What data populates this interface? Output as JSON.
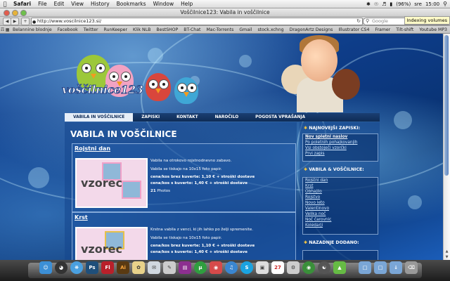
{
  "menubar": {
    "app_name": "Safari",
    "menus": [
      "File",
      "Edit",
      "View",
      "History",
      "Bookmarks",
      "Window",
      "Help"
    ],
    "battery": "(96%)",
    "day": "sre",
    "time": "15:00"
  },
  "window": {
    "title": "Voščilnice123: Vabila in voščilnice",
    "tooltip": "Indexing volumes"
  },
  "toolbar": {
    "url": "http://www.voscilnice123.si/",
    "search_placeholder": "Google"
  },
  "bookmarks": [
    "Belannine blodnje",
    "Facebook",
    "Twitter",
    "RunKeeper",
    "Klik NLB",
    "BestSHOP",
    "BT-Chat",
    "Mac-Torrents",
    "Gmail",
    "stock.xchng",
    "DragonArtz Designs",
    "Illustrator CS4",
    "Framer",
    "Tilt-shift",
    "Youtube MP3"
  ],
  "logo": {
    "text": "voščilnice123"
  },
  "nav": {
    "tabs": [
      "VABILA IN VOŠČILNICE",
      "ZAPISKI",
      "KONTAKT",
      "NAROČILO",
      "POGOSTA VPRAŠANJA"
    ]
  },
  "main": {
    "heading": "VABILA IN VOŠČILNICE",
    "cards": [
      {
        "title": "Rojstni dan",
        "watermark": "vzorec",
        "line1": "Vabila na otrokovo rojstnodnevno zabavo.",
        "line2": "Vabila se tiskajo na 10x15 foto papir.",
        "price1": "cena/kos brez kuverte: 1,10 € + stroški dostave",
        "price2": "cena/kos s kuverto: 1,40 € + stroški dostave",
        "photos_count": "21",
        "photos_label": "Photos"
      },
      {
        "title": "Krst",
        "watermark": "vzorec",
        "line1": "Krstna vabila z venci, ki jih lahko po želji spremenite.",
        "line2": "Vabila se tiskajo na 10x15 foto papir.",
        "price1": "cena/kos brez kuverte: 1,10 € + stroški dostave",
        "price2": "cena/kos s kuverto: 1,40 € + stroški dostave"
      }
    ]
  },
  "sidebar": {
    "section1_title": "NAJNOVEJŠI ZAPISKI:",
    "section1_links": [
      "Nov spletni naslov",
      "Po poletnih pohajkovanjih",
      "Vsi obstoječi vzorčki",
      "Prvi zapis"
    ],
    "section2_title": "VABILA & VOŠČILNICE:",
    "section2_links": [
      "Rojstni dan",
      "Krst",
      "Obhajilo",
      "Rojstvo",
      "Novo leto",
      "Valentinovo",
      "Velika noč",
      "Noč čarovnic",
      "Koledarji"
    ],
    "section3_title": "NAZADNJE DODANO:"
  },
  "dock": {
    "apps": [
      "Finder",
      "Dashboard",
      "Safari",
      "Photoshop",
      "Flash",
      "Illustrator",
      "Photos",
      "Mail",
      "iTunes",
      "uTorrent",
      "Skype",
      "Preview",
      "Calendar",
      "Chrome",
      "Activity",
      "Downloads",
      "Trash"
    ]
  }
}
